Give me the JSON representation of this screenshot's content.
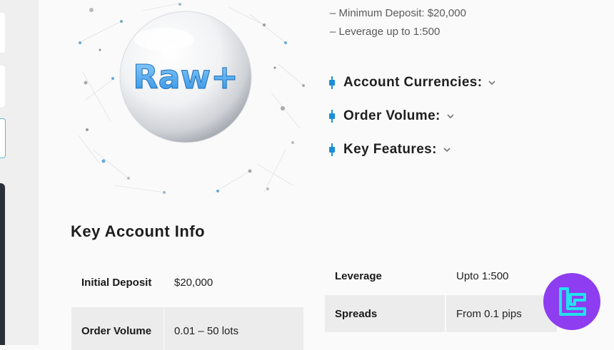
{
  "hero": {
    "logo_text": "Raw+"
  },
  "deposit": {
    "line1": "– Minimum Deposit: $20,000",
    "line2": "– Leverage up to 1:500"
  },
  "accordion": [
    {
      "label": "Account Currencies:"
    },
    {
      "label": "Order Volume:"
    },
    {
      "label": "Key Features:"
    }
  ],
  "key_info": {
    "title": "Key Account Info",
    "left": [
      {
        "key": "Initial Deposit",
        "value": "$20,000"
      },
      {
        "key": "Order Volume",
        "value": "0.01 – 50 lots"
      }
    ],
    "right": [
      {
        "key": "Leverage",
        "value": "Upto 1:500"
      },
      {
        "key": "Spreads",
        "value": "From 0.1 pips"
      }
    ]
  },
  "colors": {
    "accent": "#1a8fd6",
    "badge": "#8e3df0",
    "badge_icon": "#21e3ee"
  },
  "icons": {
    "accordion_marker": "candle-icon",
    "accordion_toggle": "chevron-down-icon",
    "brand": "tf-logo-icon"
  }
}
